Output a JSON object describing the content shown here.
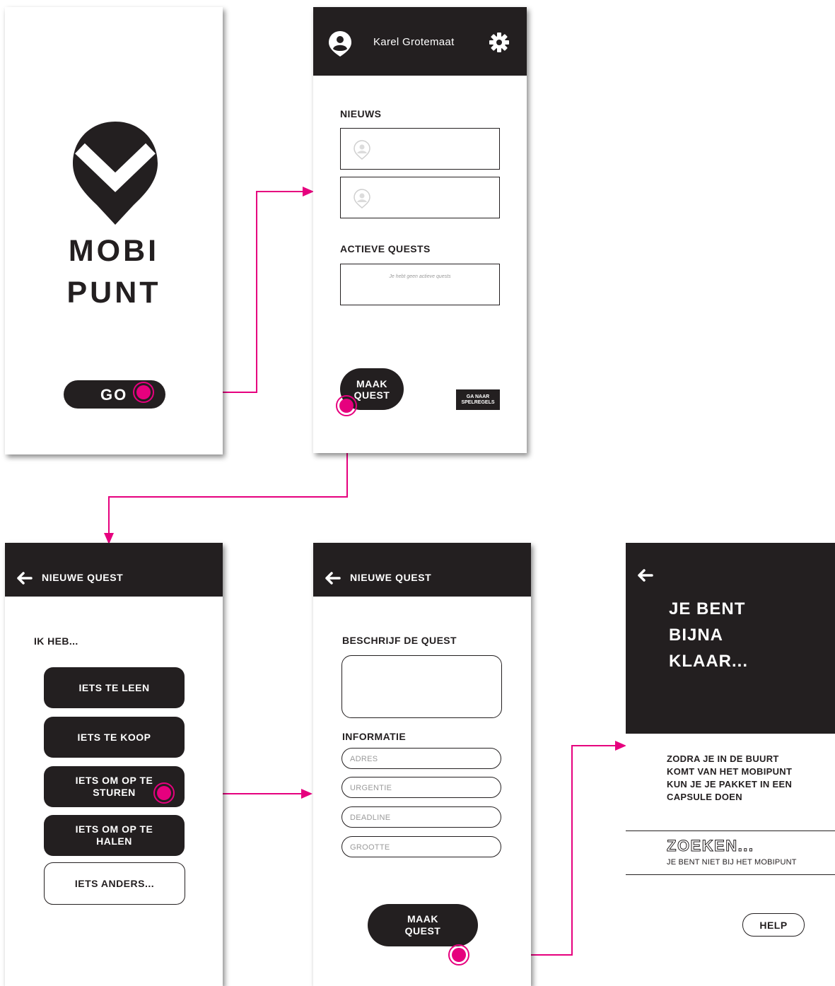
{
  "colors": {
    "dark": "#231f20",
    "accent": "#e6007e",
    "field_text": "#9a9a9a"
  },
  "splash": {
    "logo_icon": "map-pin-check-icon",
    "logo_line1": "MOBI",
    "logo_line2": "PUNT",
    "go_button": "GO"
  },
  "home": {
    "user_name": "Karel Grotemaat",
    "avatar_icon": "user-pin-icon",
    "settings_icon": "gear-icon",
    "news_heading": "NIEUWS",
    "news_item_icon": "pin-icon",
    "quests_heading": "ACTIEVE QUESTS",
    "quests_empty": "Je hebt geen actieve quests",
    "make_quest_button": "MAAK QUEST",
    "rules_button": "GA NAAR SPELREGELS"
  },
  "new_quest_type": {
    "title": "NIEUWE QUEST",
    "back_icon": "arrow-left-icon",
    "prompt": "IK HEB...",
    "options": [
      {
        "label": "IETS TE LEEN"
      },
      {
        "label": "IETS TE KOOP"
      },
      {
        "label": "IETS OM OP TE STUREN"
      },
      {
        "label": "IETS OM OP TE HALEN"
      },
      {
        "label": "IETS ANDERS..."
      }
    ]
  },
  "new_quest_form": {
    "title": "NIEUWE QUEST",
    "back_icon": "arrow-left-icon",
    "describe_heading": "BESCHRIJF DE QUEST",
    "info_heading": "INFORMATIE",
    "fields": [
      {
        "placeholder": "ADRES"
      },
      {
        "placeholder": "URGENTIE"
      },
      {
        "placeholder": "DEADLINE"
      },
      {
        "placeholder": "GROOTTE"
      }
    ],
    "submit_button": "MAAK QUEST"
  },
  "almost_done": {
    "back_icon": "arrow-left-icon",
    "headline_line1": "JE BENT",
    "headline_line2": "BIJNA",
    "headline_line3": "KLAAR...",
    "instruction": "ZODRA JE IN DE BUURT KOMT VAN HET MOBIPUNT KUN JE JE PAKKET IN EEN CAPSULE DOEN",
    "search_status": "ZOEKEN...",
    "search_detail": "JE BENT NIET BIJ HET MOBIPUNT",
    "help_button": "HELP"
  }
}
